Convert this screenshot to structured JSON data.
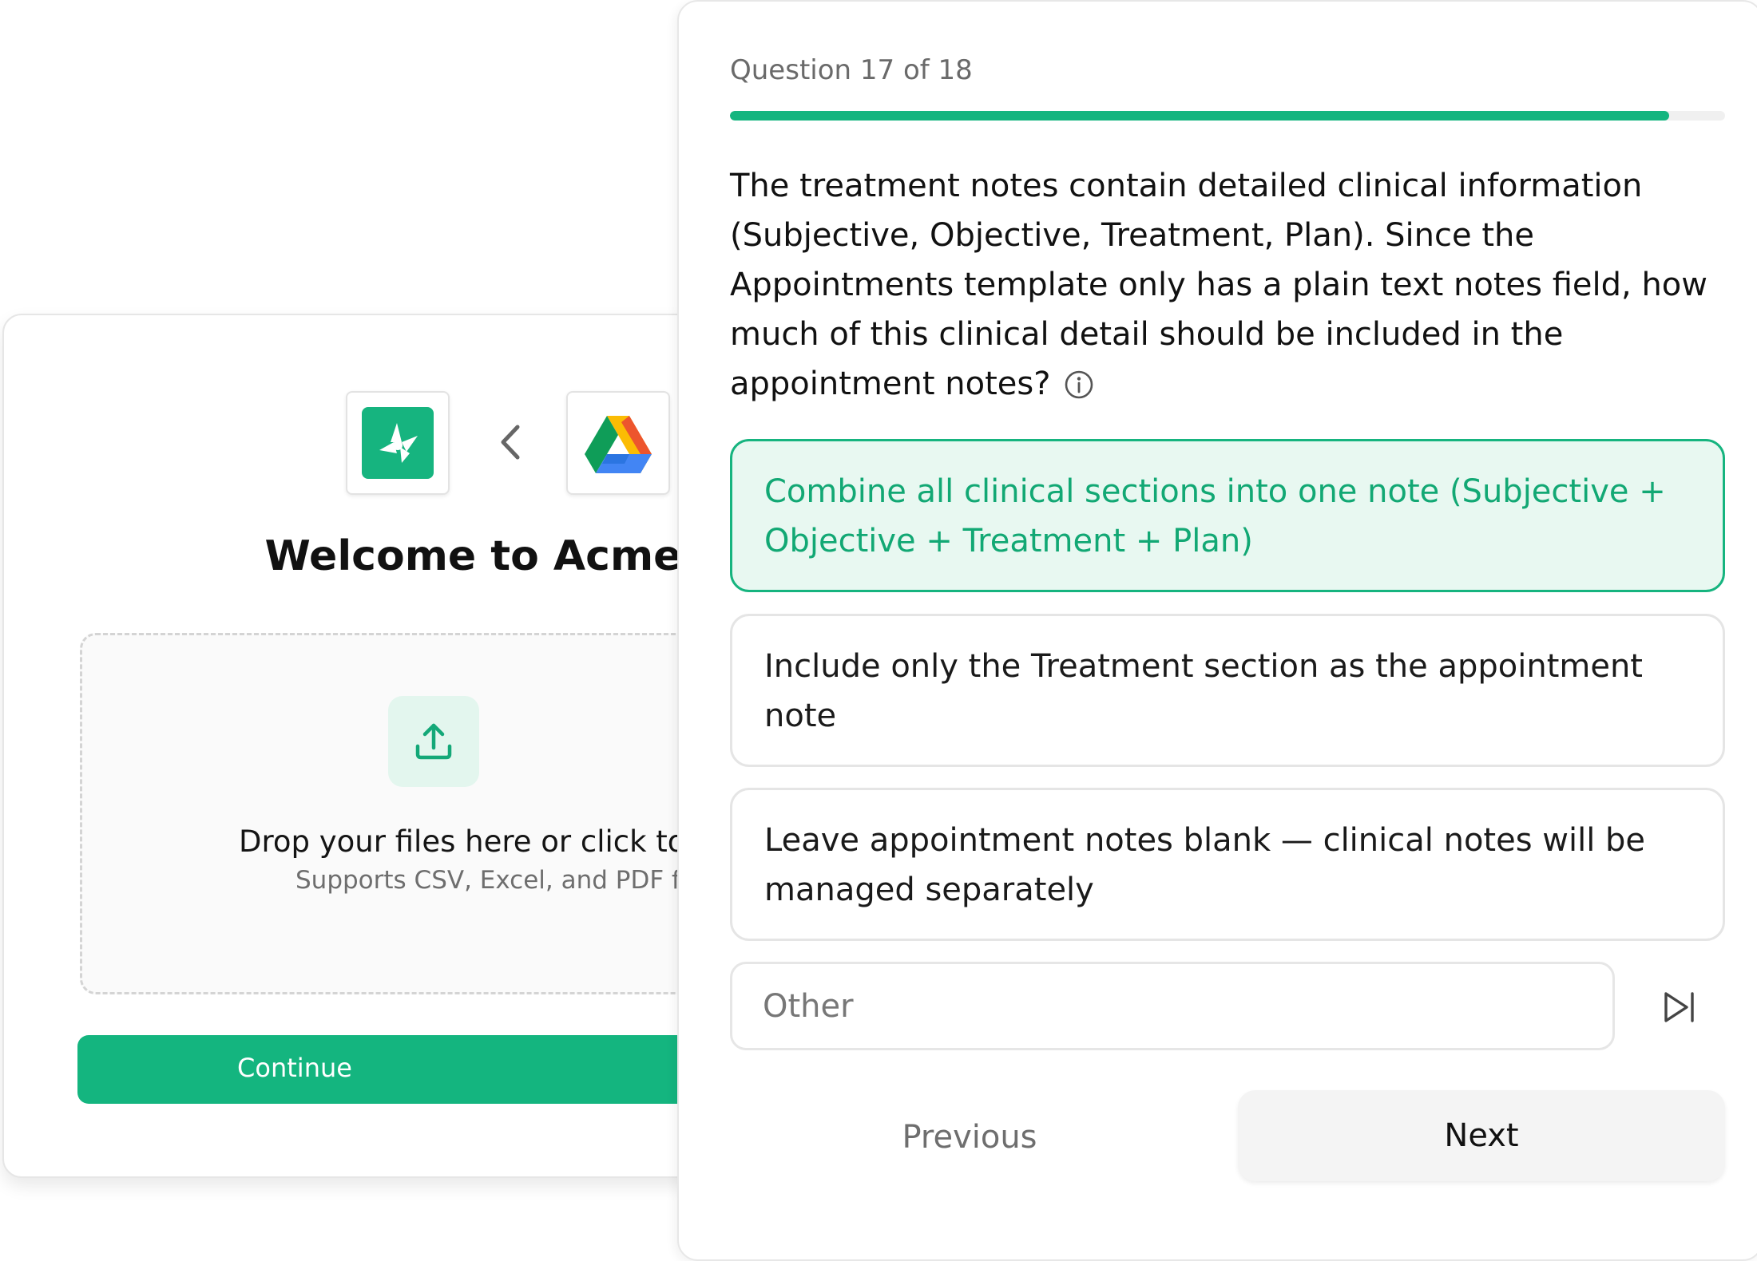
{
  "background_card": {
    "title": "Welcome to Acme",
    "source_chevron_icon": "chevron-left-icon",
    "app_logos": [
      "acme-logo",
      "google-drive-logo"
    ],
    "dropzone": {
      "icon": "upload-icon",
      "primary_text": "Drop your files here or click to b",
      "secondary_text": "Supports CSV, Excel, and PDF f"
    },
    "continue_label": "Continue"
  },
  "question_panel": {
    "counter": "Question 17 of 18",
    "progress": 0.944,
    "question_text": "The treatment notes contain detailed clinical information (Subjective, Objective, Treatment, Plan). Since the Appointments template only has a plain text notes field, how much of this clinical detail should be included in the appointment notes?",
    "info_icon": "info-icon",
    "options": [
      {
        "label": "Combine all clinical sections into one note (Subjective + Objective + Treatment + Plan)",
        "selected": true
      },
      {
        "label": "Include only the Treatment section as the appointment note",
        "selected": false
      },
      {
        "label": "Leave appointment notes blank — clinical notes will be managed separately",
        "selected": false
      }
    ],
    "other": {
      "placeholder": "Other",
      "value": ""
    },
    "skip_icon": "skip-forward-icon",
    "previous_label": "Previous",
    "next_label": "Next"
  },
  "colors": {
    "accent": "#14b57f",
    "selected_bg": "#e8f8f1",
    "selected_text": "#12a874"
  }
}
